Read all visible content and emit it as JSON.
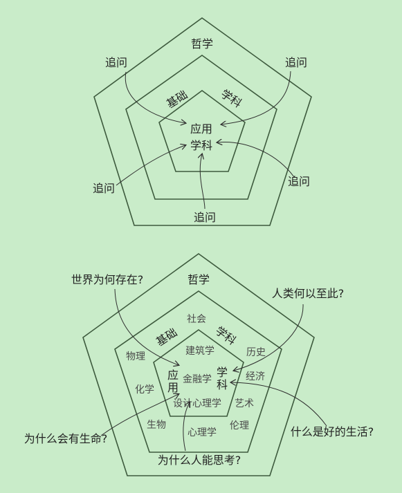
{
  "diagram1": {
    "outer": "哲学",
    "middle": [
      "基础",
      "学科"
    ],
    "inner": [
      "应用",
      "学科"
    ],
    "ask": [
      "追问",
      "追问",
      "追问",
      "追问",
      "追问"
    ]
  },
  "diagram2": {
    "outer": "哲学",
    "middle": [
      "基础",
      "学科"
    ],
    "inner": [
      "应",
      "用",
      "学",
      "科"
    ],
    "topics": [
      "社会",
      "物理",
      "化学",
      "生物",
      "历史",
      "经济",
      "艺术",
      "伦理",
      "心理学",
      "建筑学",
      "金融学",
      "设计心理学"
    ],
    "questions": [
      "世界为何存在?",
      "人类何以至此?",
      "为什么会有生命?",
      "什么是好的生活?",
      "为什么人能思考?"
    ]
  },
  "colors": {
    "background": "#c9ecc9",
    "stroke": "#3d5a3d"
  }
}
